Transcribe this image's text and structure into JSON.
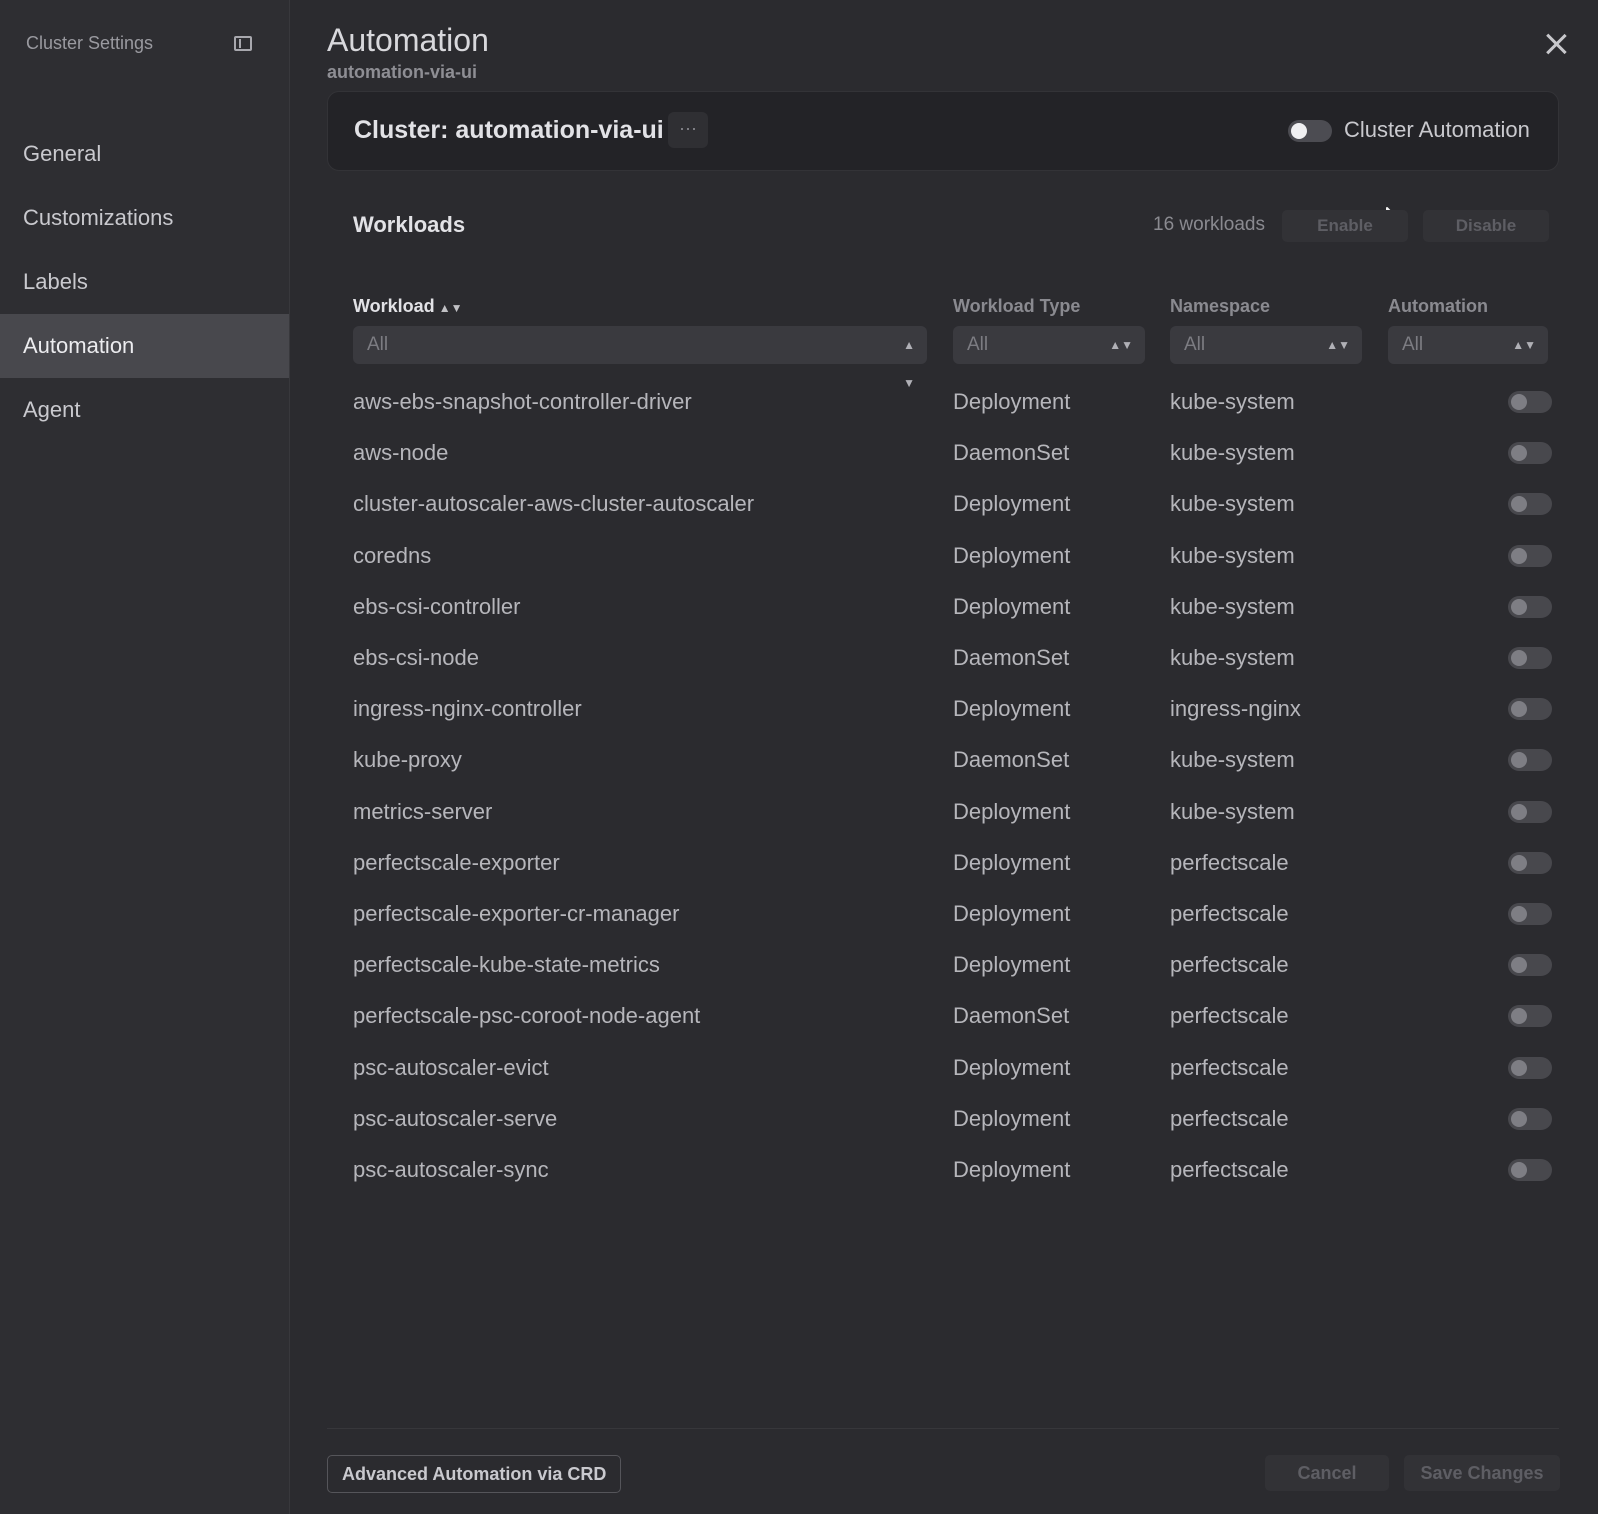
{
  "sidebar": {
    "title": "Cluster Settings",
    "items": [
      {
        "label": "General"
      },
      {
        "label": "Customizations"
      },
      {
        "label": "Labels"
      },
      {
        "label": "Automation"
      },
      {
        "label": "Agent"
      }
    ],
    "active": "Automation"
  },
  "header": {
    "title": "Automation",
    "subtitle": "automation-via-ui"
  },
  "cluster": {
    "name": "Cluster: automation-via-ui",
    "more_label": "···",
    "automation_label": "Cluster Automation",
    "automation_enabled": false
  },
  "workloads": {
    "title": "Workloads",
    "count_text": "16 workloads",
    "enable_label": "Enable",
    "disable_label": "Disable",
    "columns": {
      "workload": "Workload",
      "type": "Workload Type",
      "namespace": "Namespace",
      "automation": "Automation"
    },
    "filters": {
      "workload": "All",
      "type": "All",
      "namespace": "All",
      "automation": "All"
    },
    "rows": [
      {
        "name": "aws-ebs-snapshot-controller-driver",
        "type": "Deployment",
        "namespace": "kube-system",
        "enabled": false
      },
      {
        "name": "aws-node",
        "type": "DaemonSet",
        "namespace": "kube-system",
        "enabled": false
      },
      {
        "name": "cluster-autoscaler-aws-cluster-autoscaler",
        "type": "Deployment",
        "namespace": "kube-system",
        "enabled": false
      },
      {
        "name": "coredns",
        "type": "Deployment",
        "namespace": "kube-system",
        "enabled": false
      },
      {
        "name": "ebs-csi-controller",
        "type": "Deployment",
        "namespace": "kube-system",
        "enabled": false
      },
      {
        "name": "ebs-csi-node",
        "type": "DaemonSet",
        "namespace": "kube-system",
        "enabled": false
      },
      {
        "name": "ingress-nginx-controller",
        "type": "Deployment",
        "namespace": "ingress-nginx",
        "enabled": false
      },
      {
        "name": "kube-proxy",
        "type": "DaemonSet",
        "namespace": "kube-system",
        "enabled": false
      },
      {
        "name": "metrics-server",
        "type": "Deployment",
        "namespace": "kube-system",
        "enabled": false
      },
      {
        "name": "perfectscale-exporter",
        "type": "Deployment",
        "namespace": "perfectscale",
        "enabled": false
      },
      {
        "name": "perfectscale-exporter-cr-manager",
        "type": "Deployment",
        "namespace": "perfectscale",
        "enabled": false
      },
      {
        "name": "perfectscale-kube-state-metrics",
        "type": "Deployment",
        "namespace": "perfectscale",
        "enabled": false
      },
      {
        "name": "perfectscale-psc-coroot-node-agent",
        "type": "DaemonSet",
        "namespace": "perfectscale",
        "enabled": false
      },
      {
        "name": "psc-autoscaler-evict",
        "type": "Deployment",
        "namespace": "perfectscale",
        "enabled": false
      },
      {
        "name": "psc-autoscaler-serve",
        "type": "Deployment",
        "namespace": "perfectscale",
        "enabled": false
      },
      {
        "name": "psc-autoscaler-sync",
        "type": "Deployment",
        "namespace": "perfectscale",
        "enabled": false
      }
    ]
  },
  "footer": {
    "crd_label": "Advanced Automation via CRD",
    "cancel_label": "Cancel",
    "save_label": "Save Changes"
  }
}
